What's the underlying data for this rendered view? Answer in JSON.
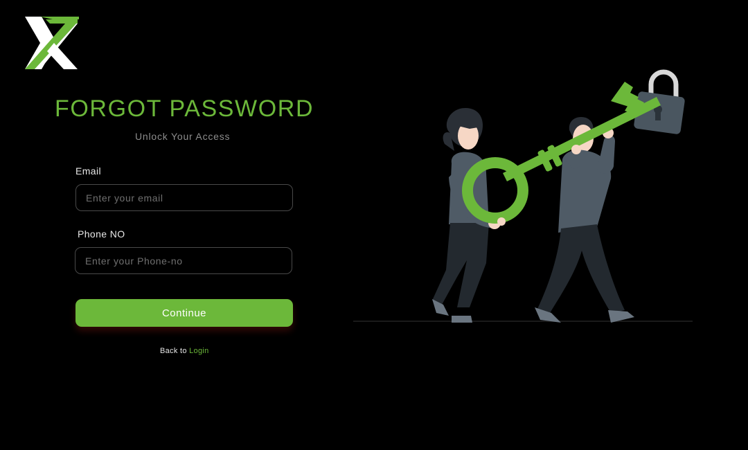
{
  "brand": {
    "logo_icon": "tx-monogram-logo",
    "accent_color": "#6cb83a"
  },
  "form": {
    "title": "FORGOT PASSWORD",
    "subtitle": "Unlock Your Access",
    "email": {
      "label": "Email",
      "placeholder": "Enter your email",
      "value": ""
    },
    "phone": {
      "label": "Phone NO",
      "placeholder": "Enter your Phone-no",
      "value": ""
    },
    "continue_label": "Continue",
    "back_text": "Back to ",
    "login_link": "Login"
  },
  "illustration": {
    "icon": "people-carrying-key-illustration",
    "lock_icon": "padlock-icon",
    "key_icon": "key-icon"
  }
}
